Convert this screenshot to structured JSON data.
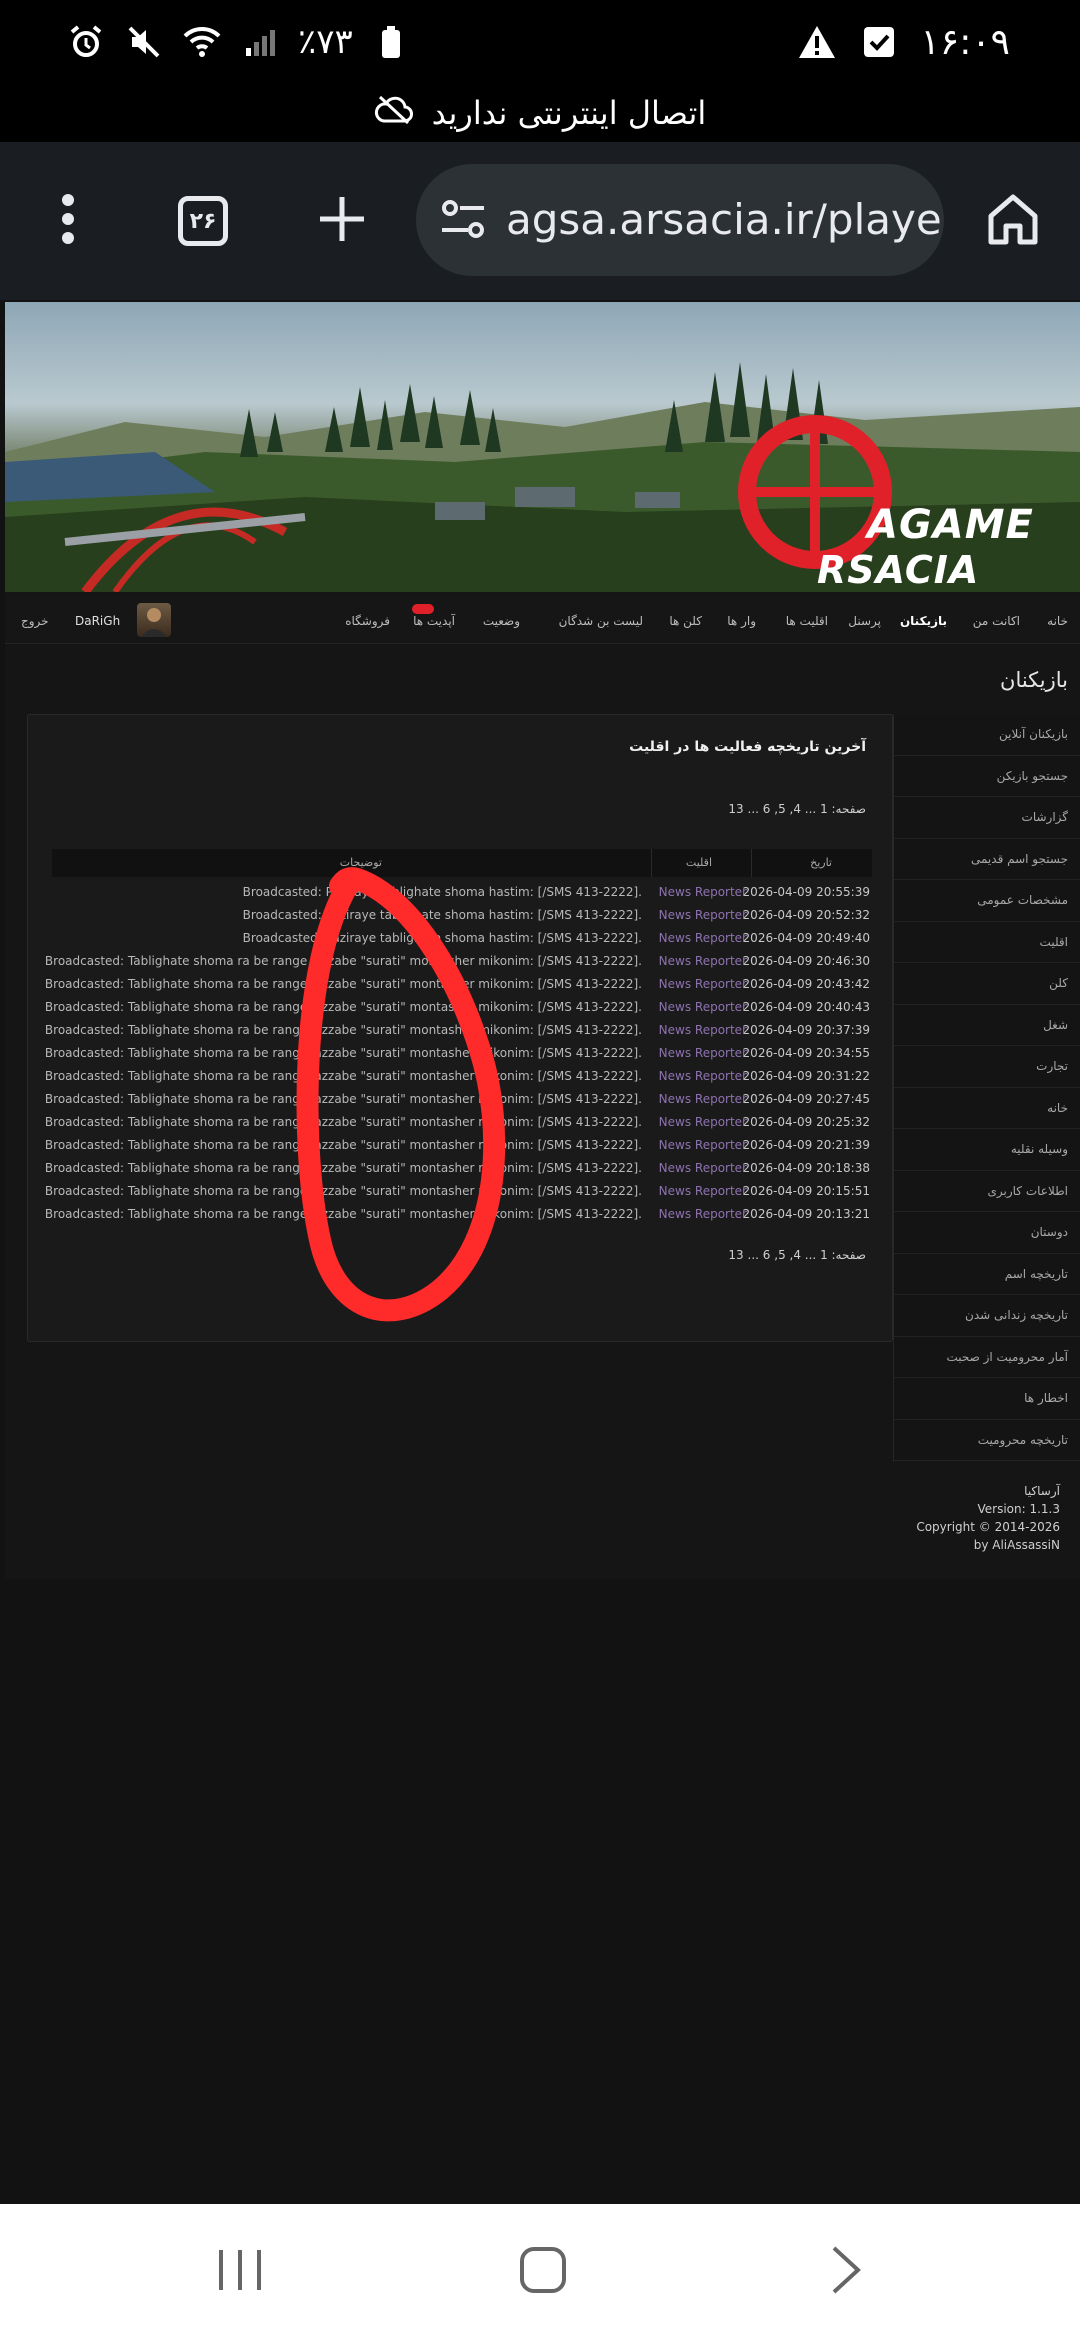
{
  "status_bar": {
    "time": "۱۶:۰۹",
    "battery": "٪۷۳"
  },
  "offline_banner": {
    "text": "اتصال اینترنتی ندارید"
  },
  "browser": {
    "url": "agsa.arsacia.ir/playe",
    "tab_count": "۲۶"
  },
  "site": {
    "logo_line1": "AGAME",
    "logo_line2": "RSACIA",
    "nav": [
      {
        "label": "خانه"
      },
      {
        "label": "اکانت من"
      },
      {
        "label": "بازیکنان",
        "active": true
      },
      {
        "label": "پرسنل"
      },
      {
        "label": "اقلیت ها"
      },
      {
        "label": "وار ها"
      },
      {
        "label": "کلن ها"
      },
      {
        "label": "لیست بن شدگان"
      },
      {
        "label": "وضعیت"
      },
      {
        "label": "آپدیت ها"
      },
      {
        "label": "فروشگاه"
      }
    ],
    "user": {
      "name": "DaRiGh",
      "logout": "خروج"
    },
    "page_title": "بازیکنان",
    "side_menu": [
      "بازیکنان آنلاین",
      "جستجو بازیکن",
      "گزارشات",
      "جستجو اسم قدیمی",
      "مشخصات عمومی",
      "اقلیت",
      "کلن",
      "شغل",
      "تجارت",
      "خانه",
      "وسیله نقلیه",
      "اطلاعات کاربری",
      "دوستان",
      "تاریخچه اسم",
      "تاریخچه زندانی شدن",
      "آمار محرومیت از صحبت",
      "اخطار ها",
      "تاریخچه محرومیت"
    ],
    "panel_title": "آخرین تاریخچه فعالیت ها در اقلیت",
    "pager_top": "صفحه: 1 ... 4, 5, 6 ... 13",
    "pager_bottom": "صفحه: 1 ... 4, 5, 6 ... 13",
    "table": {
      "headers": {
        "date": "تاریخ",
        "minority": "اقلیت",
        "desc": "توضیحات"
      },
      "rows": [
        {
          "date": "2026-04-09 20:55:39",
          "minority": "News Reporter",
          "desc": "Broadcasted: Paziraye tablighate shoma hastim: [/SMS 413-2222]."
        },
        {
          "date": "2026-04-09 20:52:32",
          "minority": "News Reporter",
          "desc": "Broadcasted: Paziraye tablighate shoma hastim: [/SMS 413-2222]."
        },
        {
          "date": "2026-04-09 20:49:40",
          "minority": "News Reporter",
          "desc": "Broadcasted: Paziraye tablighate shoma hastim: [/SMS 413-2222]."
        },
        {
          "date": "2026-04-09 20:46:30",
          "minority": "News Reporter",
          "desc": "Broadcasted: Tablighate shoma ra be range jazzabe \"surati\" montasher mikonim: [/SMS 413-2222]."
        },
        {
          "date": "2026-04-09 20:43:42",
          "minority": "News Reporter",
          "desc": "Broadcasted: Tablighate shoma ra be range jazzabe \"surati\" montasher mikonim: [/SMS 413-2222]."
        },
        {
          "date": "2026-04-09 20:40:43",
          "minority": "News Reporter",
          "desc": "Broadcasted: Tablighate shoma ra be range jazzabe \"surati\" montasher mikonim: [/SMS 413-2222]."
        },
        {
          "date": "2026-04-09 20:37:39",
          "minority": "News Reporter",
          "desc": "Broadcasted: Tablighate shoma ra be range jazzabe \"surati\" montasher mikonim: [/SMS 413-2222]."
        },
        {
          "date": "2026-04-09 20:34:55",
          "minority": "News Reporter",
          "desc": "Broadcasted: Tablighate shoma ra be range jazzabe \"surati\" montasher mikonim: [/SMS 413-2222]."
        },
        {
          "date": "2026-04-09 20:31:22",
          "minority": "News Reporter",
          "desc": "Broadcasted: Tablighate shoma ra be range jazzabe \"surati\" montasher mikonim: [/SMS 413-2222]."
        },
        {
          "date": "2026-04-09 20:27:45",
          "minority": "News Reporter",
          "desc": "Broadcasted: Tablighate shoma ra be range jazzabe \"surati\" montasher mikonim: [/SMS 413-2222]."
        },
        {
          "date": "2026-04-09 20:25:32",
          "minority": "News Reporter",
          "desc": "Broadcasted: Tablighate shoma ra be range jazzabe \"surati\" montasher mikonim: [/SMS 413-2222]."
        },
        {
          "date": "2026-04-09 20:21:39",
          "minority": "News Reporter",
          "desc": "Broadcasted: Tablighate shoma ra be range jazzabe \"surati\" montasher mikonim: [/SMS 413-2222]."
        },
        {
          "date": "2026-04-09 20:18:38",
          "minority": "News Reporter",
          "desc": "Broadcasted: Tablighate shoma ra be range jazzabe \"surati\" montasher mikonim: [/SMS 413-2222]."
        },
        {
          "date": "2026-04-09 20:15:51",
          "minority": "News Reporter",
          "desc": "Broadcasted: Tablighate shoma ra be range jazzabe \"surati\" montasher mikonim: [/SMS 413-2222]."
        },
        {
          "date": "2026-04-09 20:13:21",
          "minority": "News Reporter",
          "desc": "Broadcasted: Tablighate shoma ra be range jazzabe \"surati\" montasher mikonim: [/SMS 413-2222]."
        }
      ]
    },
    "footer": {
      "name": "آرساکیا",
      "version": "Version: 1.1.3",
      "copyright": "Copyright © 2014-2026",
      "author": "by AliAssassiN"
    }
  },
  "colors": {
    "minority_link": "#8e72b0",
    "annotation": "#ff2a2a",
    "logo_red": "#e0212a"
  }
}
